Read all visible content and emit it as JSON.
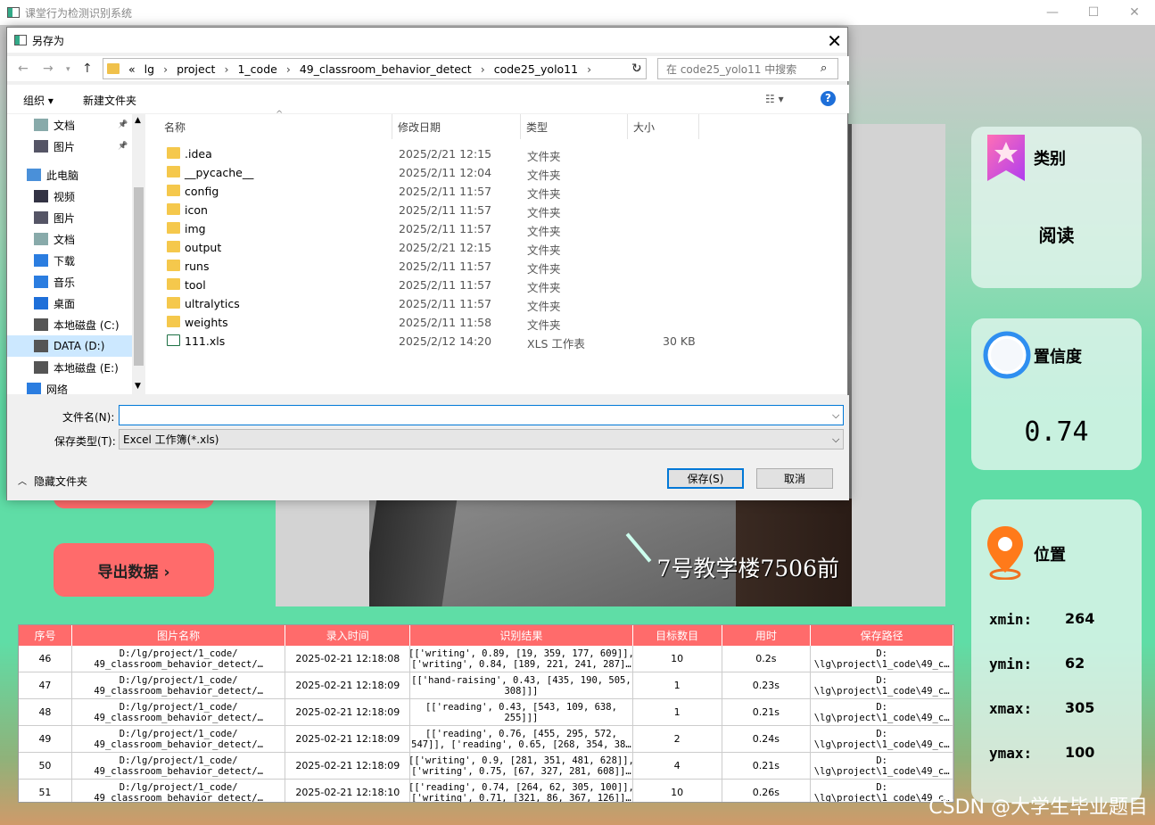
{
  "window": {
    "title": "课堂行为检测识别系统",
    "controls": [
      "—",
      "☐",
      "✕"
    ]
  },
  "left_buttons": {
    "export_label": "导出数据 ›"
  },
  "video": {
    "caption": "7号教学楼7506前"
  },
  "cards": {
    "category": {
      "title": "类别",
      "value": "阅读"
    },
    "confidence": {
      "title": "置信度",
      "value": "0.74"
    },
    "position": {
      "title": "位置",
      "xmin_label": "xmin:",
      "xmin": "264",
      "ymin_label": "ymin:",
      "ymin": "62",
      "xmax_label": "xmax:",
      "xmax": "305",
      "ymax_label": "ymax:",
      "ymax": "100"
    }
  },
  "table": {
    "headers": [
      "序号",
      "图片名称",
      "录入时间",
      "识别结果",
      "目标数目",
      "用时",
      "保存路径"
    ],
    "rows": [
      {
        "id": "46",
        "name": "D:/lg/project/1_code/\n49_classroom_behavior_detect/…",
        "time": "2025-02-21 12:18:08",
        "result": "[['writing', 0.89, [19, 359, 177, 609]],\n['writing', 0.84, [189, 221, 241, 287]…",
        "count": "10",
        "cost": "0.2s",
        "path": "D:\n\\lg\\project\\1_code\\49_c…"
      },
      {
        "id": "47",
        "name": "D:/lg/project/1_code/\n49_classroom_behavior_detect/…",
        "time": "2025-02-21 12:18:09",
        "result": "[['hand-raising', 0.43, [435, 190, 505,\n308]]]",
        "count": "1",
        "cost": "0.23s",
        "path": "D:\n\\lg\\project\\1_code\\49_c…"
      },
      {
        "id": "48",
        "name": "D:/lg/project/1_code/\n49_classroom_behavior_detect/…",
        "time": "2025-02-21 12:18:09",
        "result": "[['reading', 0.43, [543, 109, 638,\n255]]]",
        "count": "1",
        "cost": "0.21s",
        "path": "D:\n\\lg\\project\\1_code\\49_c…"
      },
      {
        "id": "49",
        "name": "D:/lg/project/1_code/\n49_classroom_behavior_detect/…",
        "time": "2025-02-21 12:18:09",
        "result": "[['reading', 0.76, [455, 295, 572,\n547]], ['reading', 0.65, [268, 354, 38…",
        "count": "2",
        "cost": "0.24s",
        "path": "D:\n\\lg\\project\\1_code\\49_c…"
      },
      {
        "id": "50",
        "name": "D:/lg/project/1_code/\n49_classroom_behavior_detect/…",
        "time": "2025-02-21 12:18:09",
        "result": "[['writing', 0.9, [281, 351, 481, 628]],\n['writing', 0.75, [67, 327, 281, 608]]…",
        "count": "4",
        "cost": "0.21s",
        "path": "D:\n\\lg\\project\\1_code\\49_c…"
      },
      {
        "id": "51",
        "name": "D:/lg/project/1_code/\n49_classroom_behavior_detect/…",
        "time": "2025-02-21 12:18:10",
        "result": "[['reading', 0.74, [264, 62, 305, 100]],\n['writing', 0.71, [321, 86, 367, 126]]…",
        "count": "10",
        "cost": "0.26s",
        "path": "D:\n\\lg\\project\\1_code\\49_c…"
      }
    ]
  },
  "watermark": "CSDN @大学生毕业题目",
  "dialog": {
    "title": "另存为",
    "breadcrumb": [
      "«",
      "lg",
      "project",
      "1_code",
      "49_classroom_behavior_detect",
      "code25_yolo11"
    ],
    "search_placeholder": "在 code25_yolo11 中搜索",
    "toolbar": {
      "organize": "组织 ▾",
      "new_folder": "新建文件夹"
    },
    "nav_items": [
      "文档",
      "图片",
      "此电脑",
      "视频",
      "图片",
      "文档",
      "下载",
      "音乐",
      "桌面",
      "本地磁盘 (C:)",
      "DATA (D:)",
      "本地磁盘 (E:)",
      "网络"
    ],
    "columns": [
      "名称",
      "修改日期",
      "类型",
      "大小"
    ],
    "files": [
      {
        "name": ".idea",
        "date": "2025/2/21 12:15",
        "type": "文件夹",
        "size": ""
      },
      {
        "name": "__pycache__",
        "date": "2025/2/11 12:04",
        "type": "文件夹",
        "size": ""
      },
      {
        "name": "config",
        "date": "2025/2/11 11:57",
        "type": "文件夹",
        "size": ""
      },
      {
        "name": "icon",
        "date": "2025/2/11 11:57",
        "type": "文件夹",
        "size": ""
      },
      {
        "name": "img",
        "date": "2025/2/11 11:57",
        "type": "文件夹",
        "size": ""
      },
      {
        "name": "output",
        "date": "2025/2/21 12:15",
        "type": "文件夹",
        "size": ""
      },
      {
        "name": "runs",
        "date": "2025/2/11 11:57",
        "type": "文件夹",
        "size": ""
      },
      {
        "name": "tool",
        "date": "2025/2/11 11:57",
        "type": "文件夹",
        "size": ""
      },
      {
        "name": "ultralytics",
        "date": "2025/2/11 11:57",
        "type": "文件夹",
        "size": ""
      },
      {
        "name": "weights",
        "date": "2025/2/11 11:58",
        "type": "文件夹",
        "size": ""
      },
      {
        "name": "111.xls",
        "date": "2025/2/12 14:20",
        "type": "XLS 工作表",
        "size": "30 KB"
      }
    ],
    "filename_label": "文件名(N):",
    "filename_value": "",
    "filetype_label": "保存类型(T):",
    "filetype_value": "Excel 工作簿(*.xls)",
    "hide_folders": "隐藏文件夹",
    "save_button": "保存(S)",
    "cancel_button": "取消"
  }
}
